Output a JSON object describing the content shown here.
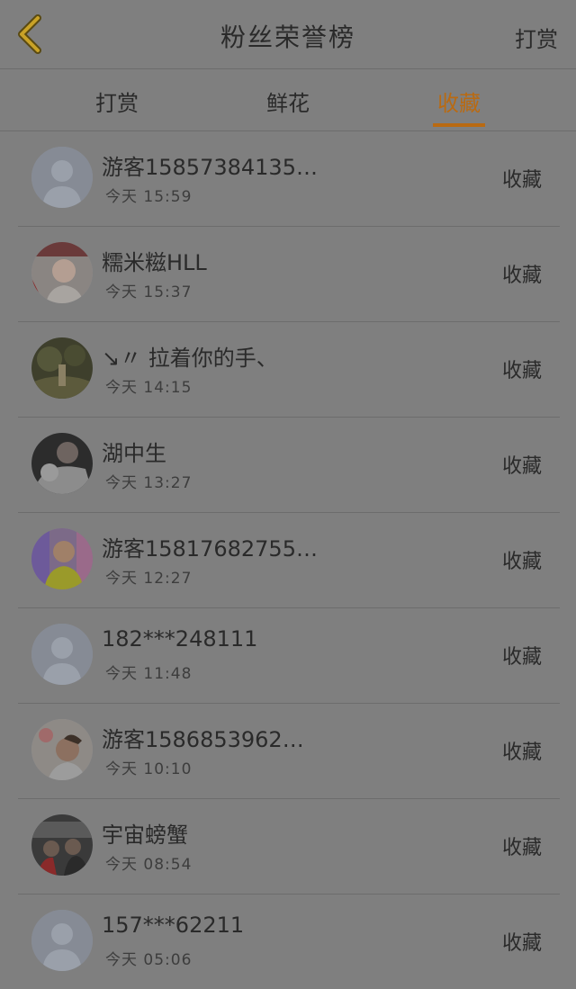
{
  "header": {
    "title": "粉丝荣誉榜",
    "right_action": "打赏"
  },
  "tabs": [
    {
      "label": "打赏",
      "active": false
    },
    {
      "label": "鲜花",
      "active": false
    },
    {
      "label": "收藏",
      "active": true
    }
  ],
  "colors": {
    "accent": "#b96a12",
    "background": "#7f7f7f",
    "divider": "#6c6c6c"
  },
  "fans": [
    {
      "name": "游客15857384135…",
      "time": "今天 15:59",
      "action": "收藏",
      "avatar": "default-avatar"
    },
    {
      "name": "糯米糍HLL",
      "time": "今天 15:37",
      "action": "收藏",
      "avatar": "photo-avatar"
    },
    {
      "name": "↘〃 拉着你的手、",
      "time": "今天 14:15",
      "action": "收藏",
      "avatar": "photo-avatar"
    },
    {
      "name": "湖中生",
      "time": "今天 13:27",
      "action": "收藏",
      "avatar": "photo-avatar"
    },
    {
      "name": "游客15817682755…",
      "time": "今天 12:27",
      "action": "收藏",
      "avatar": "photo-avatar"
    },
    {
      "name": "182***248111",
      "time": "今天 11:48",
      "action": "收藏",
      "avatar": "default-avatar"
    },
    {
      "name": "游客1586853962…",
      "time": "今天 10:10",
      "action": "收藏",
      "avatar": "photo-avatar"
    },
    {
      "name": "宇宙螃蟹",
      "time": "今天 08:54",
      "action": "收藏",
      "avatar": "photo-avatar"
    },
    {
      "name": "157***62211",
      "time": "今天 05:06",
      "action": "收藏",
      "avatar": "default-avatar"
    }
  ]
}
